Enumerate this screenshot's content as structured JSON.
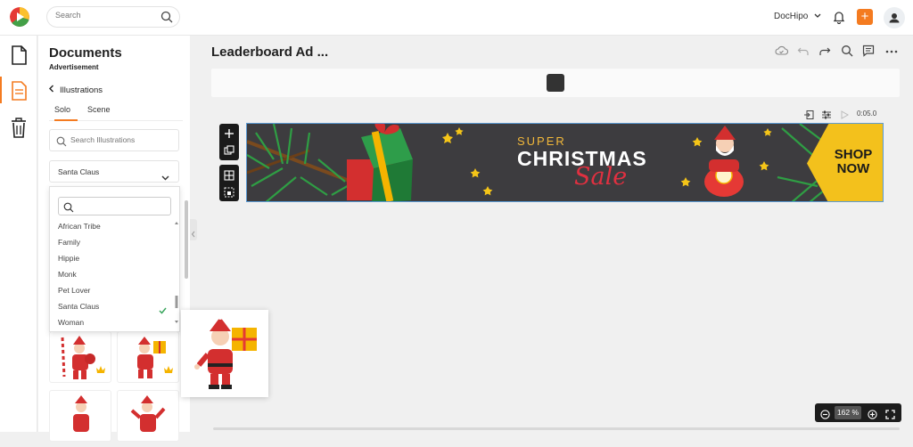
{
  "header": {
    "search_placeholder": "Search",
    "account_name": "DocHipo",
    "add_label": "+"
  },
  "panel": {
    "title": "Documents",
    "subtitle": "Advertisement",
    "back_label": "Illustrations",
    "tabs": [
      {
        "label": "Solo",
        "active": true
      },
      {
        "label": "Scene",
        "active": false
      }
    ],
    "search_placeholder": "Search Illustrations",
    "category_value": "Santa Claus",
    "dropdown_options": [
      {
        "label": "African Tribe",
        "selected": false
      },
      {
        "label": "Family",
        "selected": false
      },
      {
        "label": "Hippie",
        "selected": false
      },
      {
        "label": "Monk",
        "selected": false
      },
      {
        "label": "Pet Lover",
        "selected": false
      },
      {
        "label": "Santa Claus",
        "selected": true
      },
      {
        "label": "Woman",
        "selected": false
      }
    ]
  },
  "editor": {
    "doc_title": "Leaderboard Ad ...",
    "duration": "0:05.0",
    "zoom": "162 %"
  },
  "banner": {
    "super": "SUPER",
    "christmas": "CHRISTMAS",
    "sale": "Sale",
    "shop_now": "SHOP NOW",
    "colors": {
      "background": "#3d3c3f",
      "accent": "#f3c11c",
      "sale": "#e03040"
    }
  },
  "colors": {
    "brand": "#f47b20"
  }
}
